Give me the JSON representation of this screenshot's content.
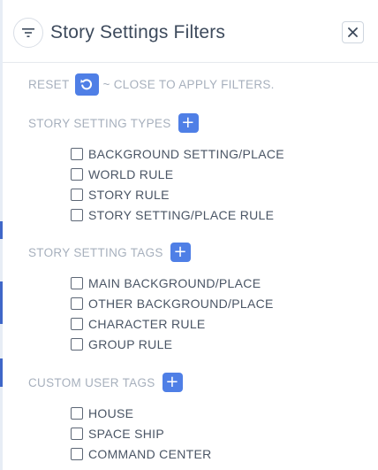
{
  "header": {
    "title": "Story Settings Filters",
    "filter_icon": "filter-icon",
    "close_icon": "close-icon"
  },
  "hint": {
    "reset_label": "RESET",
    "reset_icon": "undo-icon",
    "instruction": "~ CLOSE TO APPLY FILTERS."
  },
  "sections": [
    {
      "title": "STORY SETTING TYPES",
      "add_label": "+",
      "items": [
        "BACKGROUND SETTING/PLACE",
        "WORLD RULE",
        "STORY RULE",
        "STORY SETTING/PLACE RULE"
      ]
    },
    {
      "title": "STORY SETTING TAGS",
      "add_label": "+",
      "items": [
        "MAIN BACKGROUND/PLACE",
        "OTHER BACKGROUND/PLACE",
        "CHARACTER RULE",
        "GROUP RULE"
      ]
    },
    {
      "title": "CUSTOM USER TAGS",
      "add_label": "+",
      "items": [
        "HOUSE",
        "SPACE SHIP",
        "COMMAND CENTER"
      ]
    }
  ],
  "colors": {
    "accent": "#4f7fe6",
    "muted_text": "#a7b0bd",
    "title_text": "#3d4a5c"
  }
}
